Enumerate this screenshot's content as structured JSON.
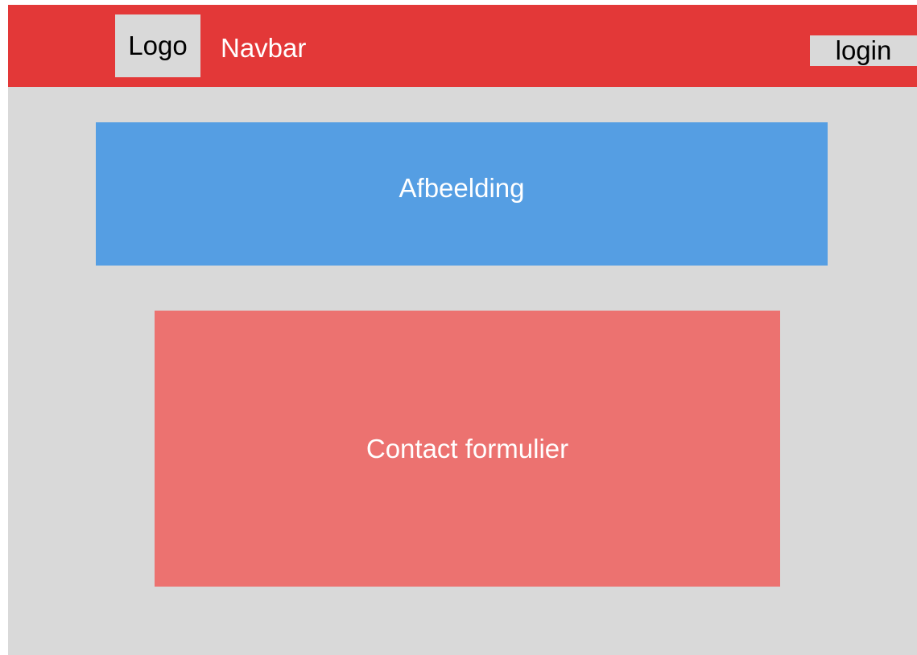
{
  "navbar": {
    "logo_label": "Logo",
    "title": "Navbar",
    "login_label": "login",
    "background_color": "#e33838"
  },
  "main": {
    "image_label": "Afbeelding",
    "image_color": "#559ee3",
    "contact_label": "Contact formulier",
    "contact_color": "#ec7270",
    "background_color": "#d9d9d9"
  }
}
